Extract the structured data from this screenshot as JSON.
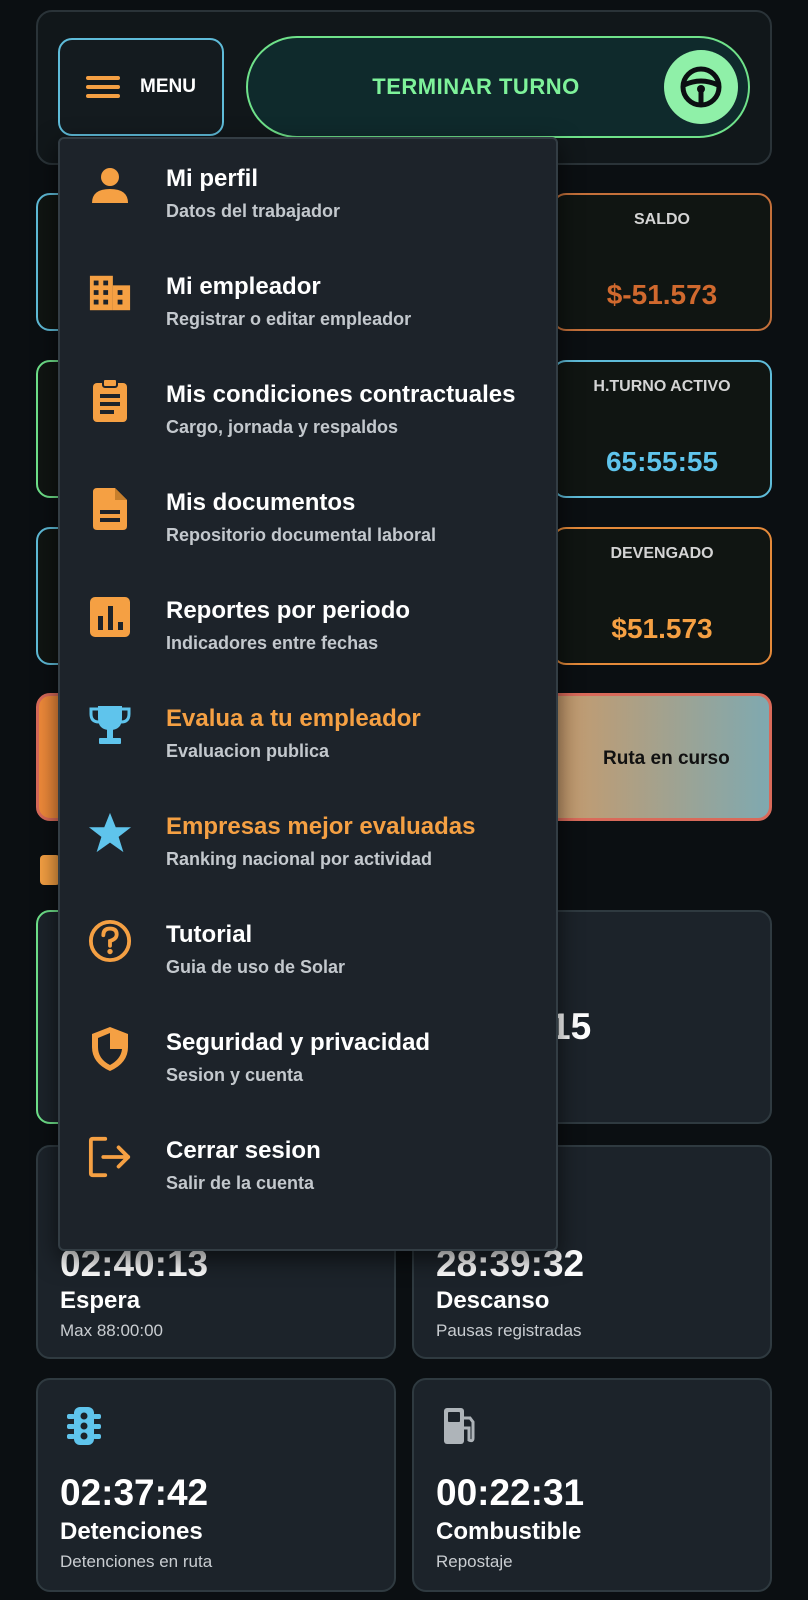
{
  "header": {
    "menu_label": "MENU",
    "end_shift_label": "TERMINAR TURNO"
  },
  "stats": [
    {
      "title": "SALDO",
      "value": "$-51.573",
      "color": "#d0692e"
    },
    {
      "title": "H.TURNO ACTIVO",
      "value": "65:55:55",
      "color": "#5fc4ec"
    },
    {
      "title": "DEVENGADO",
      "value": "$51.573",
      "color": "#f5a043"
    }
  ],
  "route_banner": {
    "label": "Ruta en curso"
  },
  "partial_card": {
    "time_fragment": "15"
  },
  "cards": [
    {
      "time": "02:40:13",
      "name": "Espera",
      "sub": "Max 88:00:00"
    },
    {
      "time": "28:39:32",
      "name": "Descanso",
      "sub": "Pausas registradas"
    },
    {
      "time": "02:37:42",
      "name": "Detenciones",
      "sub": "Detenciones en ruta",
      "icon": "traffic-light-icon"
    },
    {
      "time": "00:22:31",
      "name": "Combustible",
      "sub": "Repostaje",
      "icon": "fuel-pump-icon"
    }
  ],
  "menu": {
    "items": [
      {
        "title": "Mi perfil",
        "subtitle": "Datos del trabajador",
        "icon": "person-icon"
      },
      {
        "title": "Mi empleador",
        "subtitle": "Registrar o editar empleador",
        "icon": "building-icon"
      },
      {
        "title": "Mis condiciones contractuales",
        "subtitle": "Cargo, jornada y respaldos",
        "icon": "clipboard-icon"
      },
      {
        "title": "Mis documentos",
        "subtitle": "Repositorio documental laboral",
        "icon": "document-icon"
      },
      {
        "title": "Reportes por periodo",
        "subtitle": "Indicadores entre fechas",
        "icon": "bar-chart-icon"
      },
      {
        "title": "Evalua a tu empleador",
        "subtitle": "Evaluacion publica",
        "icon": "trophy-icon"
      },
      {
        "title": "Empresas mejor evaluadas",
        "subtitle": "Ranking nacional por actividad",
        "icon": "star-icon"
      },
      {
        "title": "Tutorial",
        "subtitle": "Guia de uso de Solar",
        "icon": "help-icon"
      },
      {
        "title": "Seguridad y privacidad",
        "subtitle": "Sesion y cuenta",
        "icon": "shield-icon"
      },
      {
        "title": "Cerrar sesion",
        "subtitle": "Salir de la cuenta",
        "icon": "logout-icon"
      }
    ]
  },
  "colors": {
    "accent_orange": "#f5a043",
    "accent_cyan": "#5fc4ec",
    "accent_green": "#6fe28a",
    "background": "#0b0f12"
  }
}
